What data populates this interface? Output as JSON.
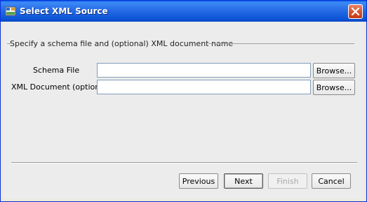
{
  "window": {
    "title": "Select XML Source",
    "icon": "app-icon",
    "close_icon": "close-icon"
  },
  "group": {
    "title": "Specify a schema file and (optional) XML document name"
  },
  "fields": {
    "schema_label": "Schema File",
    "schema_value": "",
    "xml_label": "XML Document (optional)",
    "xml_value": ""
  },
  "buttons": {
    "browse_schema": "Browse...",
    "browse_xml": "Browse...",
    "previous": "Previous",
    "next": "Next",
    "finish": "Finish",
    "cancel": "Cancel"
  },
  "colors": {
    "titlebar": "#0c54d7",
    "close_button": "#d7502c",
    "dialog_background": "#ececec"
  }
}
